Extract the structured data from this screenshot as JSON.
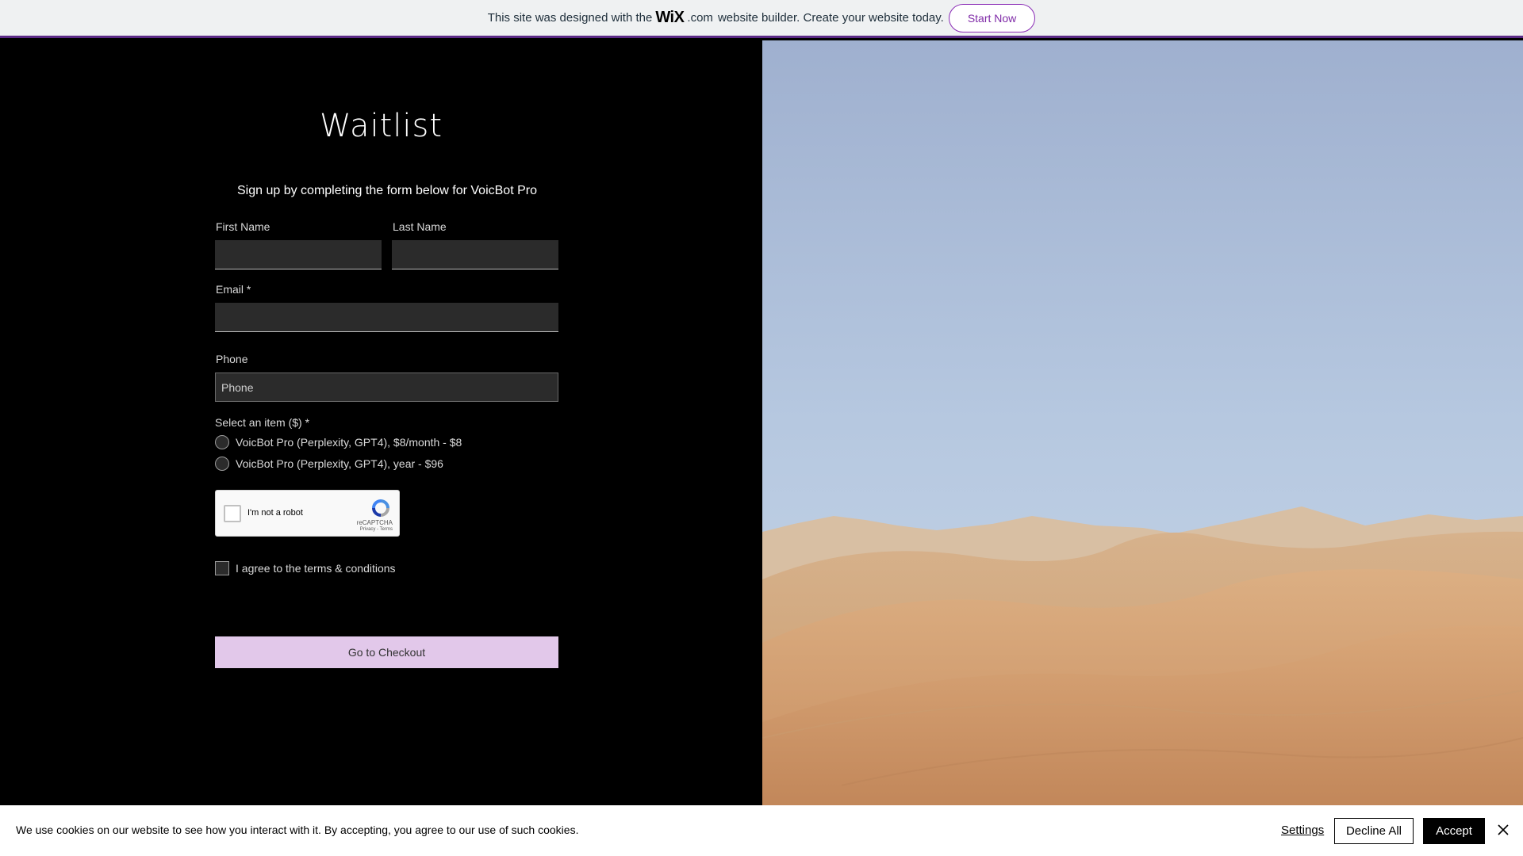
{
  "banner": {
    "text_before": "This site was designed with the",
    "logo": "WiX",
    "logo_suffix": ".com",
    "text_after": "website builder. Create your website today.",
    "button_label": "Start Now"
  },
  "form": {
    "title": "Waitlist",
    "subtitle": "Sign up by completing the form below for VoicBot Pro",
    "first_name_label": "First Name",
    "last_name_label": "Last Name",
    "email_label": "Email *",
    "phone_label": "Phone",
    "phone_placeholder": "Phone",
    "select_label": "Select an item ($) *",
    "options": [
      "VoicBot Pro (Perplexity, GPT4), $8/month - $8",
      "VoicBot Pro (Perplexity, GPT4), year - $96"
    ],
    "recaptcha": {
      "label": "I'm not a robot",
      "brand": "reCAPTCHA",
      "links": "Privacy - Terms"
    },
    "terms_label": "I agree to the terms & conditions",
    "submit_label": "Go to Checkout"
  },
  "cookie": {
    "text": "We use cookies on our website to see how you interact with it. By accepting, you agree to our use of such cookies.",
    "settings_label": "Settings",
    "decline_label": "Decline All",
    "accept_label": "Accept"
  },
  "colors": {
    "banner_accent": "#5b2a86",
    "button_purple": "#e2c8ea",
    "background": "#000000"
  }
}
